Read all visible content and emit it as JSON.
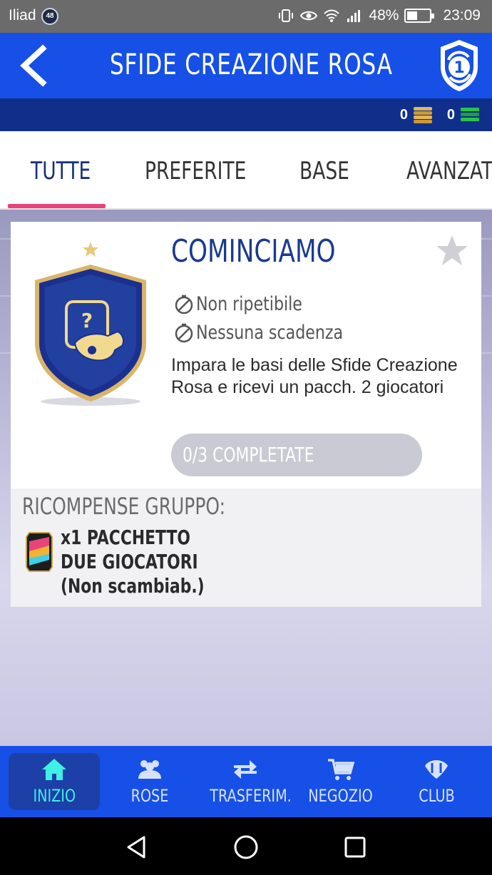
{
  "status_bar": {
    "carrier": "Iliad",
    "notification_count": "48",
    "battery": "48%",
    "battery_level": 0.48,
    "time": "23:09"
  },
  "header": {
    "title": "SFIDE CREAZIONE ROSA",
    "back_icon": "chevron-left-icon",
    "logo_icon": "sbc-logo-icon",
    "logo_text": "1",
    "brand_color": "#1650e6"
  },
  "currency": {
    "coins": "0",
    "points": "0"
  },
  "tabs": [
    {
      "label": "TUTTE",
      "active": true
    },
    {
      "label": "PREFERITE",
      "active": false
    },
    {
      "label": "BASE",
      "active": false
    },
    {
      "label": "AVANZATE",
      "active": false
    }
  ],
  "challenge": {
    "title": "COMINCIAMO",
    "repeatable": "Non ripetibile",
    "expiry": "Nessuna scadenza",
    "description": "Impara le basi delle Sfide Creazione Rosa e ricevi un pacch. 2 giocatori",
    "progress": "0/3 COMPLETATE",
    "rewards_header": "RICOMPENSE GRUPPO:",
    "reward_item": "x1 PACCHETTO DUE GIOCATORI (Non scambiab.)"
  },
  "bottom_nav": [
    {
      "label": "INIZIO",
      "icon": "home-icon",
      "active": true
    },
    {
      "label": "ROSE",
      "icon": "players-icon",
      "active": false
    },
    {
      "label": "TRASFERIM.",
      "icon": "transfer-arrows-icon",
      "active": false
    },
    {
      "label": "NEGOZIO",
      "icon": "cart-icon",
      "active": false
    },
    {
      "label": "CLUB",
      "icon": "club-icon",
      "active": false
    }
  ],
  "colors": {
    "accent_pink": "#e8437a",
    "active_nav_text": "#3ff0e4",
    "title_blue": "#1a3a8f"
  }
}
